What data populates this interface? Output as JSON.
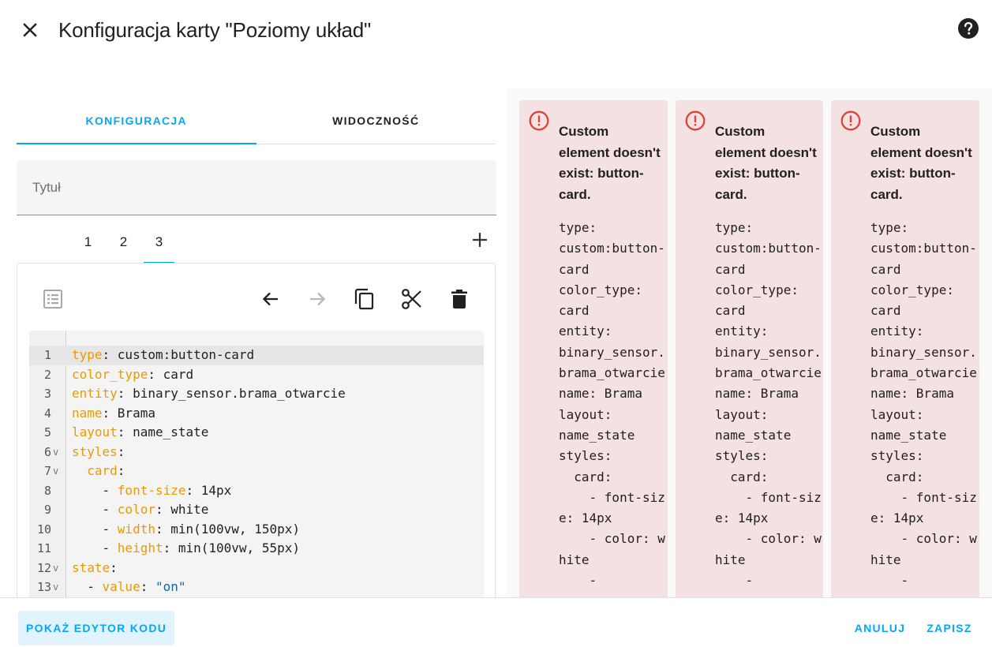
{
  "header": {
    "close_icon": "close-icon",
    "title": "Konfiguracja karty \"Poziomy układ\"",
    "help_icon": "help-circle-icon"
  },
  "tabs": [
    {
      "label": "Konfiguracja",
      "active": true
    },
    {
      "label": "Widoczność",
      "active": false
    }
  ],
  "title_field": {
    "placeholder": "Tytuł",
    "value": ""
  },
  "subtabs": {
    "items": [
      "1",
      "2",
      "3"
    ],
    "active_index": 2,
    "add_icon": "plus-icon"
  },
  "toolbar": {
    "icons": [
      "form-editor-icon",
      "arrow-left-icon",
      "arrow-right-icon",
      "copy-icon",
      "cut-icon",
      "delete-icon"
    ]
  },
  "code_editor": {
    "lines": [
      {
        "n": "1",
        "fold": "",
        "key": "type",
        "sep": ": ",
        "val": "custom:button-card",
        "indent": ""
      },
      {
        "n": "2",
        "fold": "",
        "key": "color_type",
        "sep": ": ",
        "val": "card",
        "indent": ""
      },
      {
        "n": "3",
        "fold": "",
        "key": "entity",
        "sep": ": ",
        "val": "binary_sensor.brama_otwarcie",
        "indent": ""
      },
      {
        "n": "4",
        "fold": "",
        "key": "name",
        "sep": ": ",
        "val": "Brama",
        "indent": ""
      },
      {
        "n": "5",
        "fold": "",
        "key": "layout",
        "sep": ": ",
        "val": "name_state",
        "indent": ""
      },
      {
        "n": "6",
        "fold": "v",
        "key": "styles",
        "sep": ":",
        "val": "",
        "indent": ""
      },
      {
        "n": "7",
        "fold": "v",
        "key": "card",
        "sep": ":",
        "val": "",
        "indent": "  "
      },
      {
        "n": "8",
        "fold": "",
        "key": "font-size",
        "sep": ": ",
        "val": "14px",
        "indent": "    - "
      },
      {
        "n": "9",
        "fold": "",
        "key": "color",
        "sep": ": ",
        "val": "white",
        "indent": "    - "
      },
      {
        "n": "10",
        "fold": "",
        "key": "width",
        "sep": ": ",
        "val": "min(100vw, 150px)",
        "indent": "    - "
      },
      {
        "n": "11",
        "fold": "",
        "key": "height",
        "sep": ": ",
        "val": "min(100vw, 55px)",
        "indent": "    - "
      },
      {
        "n": "12",
        "fold": "v",
        "key": "state",
        "sep": ":",
        "val": "",
        "indent": ""
      },
      {
        "n": "13",
        "fold": "v",
        "key": "value",
        "sep": ": ",
        "val": "\"on\"",
        "indent": "  - ",
        "string": true
      }
    ]
  },
  "preview": {
    "error_icon": "alert-circle-icon",
    "cards": [
      {
        "title": "Custom element doesn't exist: button-card.",
        "yaml": "type:\ncustom:button-card\ncolor_type:\ncard\nentity:\nbinary_sensor.brama_otwarcie\nname: Brama\nlayout:\nname_state\nstyles:\n  card:\n    - font-size: 14px\n    - color: white\n    -"
      },
      {
        "title": "Custom element doesn't exist: button-card.",
        "yaml": "type:\ncustom:button-card\ncolor_type:\ncard\nentity:\nbinary_sensor.brama_otwarcie\nname: Brama\nlayout:\nname_state\nstyles:\n  card:\n    - font-size: 14px\n    - color: white\n    -"
      },
      {
        "title": "Custom element doesn't exist: button-card.",
        "yaml": "type:\ncustom:button-card\ncolor_type:\ncard\nentity:\nbinary_sensor.brama_otwarcie\nname: Brama\nlayout:\nname_state\nstyles:\n  card:\n    - font-size: 14px\n    - color: white\n    -"
      }
    ]
  },
  "footer": {
    "show_code_editor": "Pokaż edytor kodu",
    "cancel": "Anuluj",
    "save": "Zapisz"
  },
  "colors": {
    "accent": "#03a9f4",
    "yaml_key": "#e99b00",
    "error_bg": "#f4e1e1",
    "error_icon": "#db4437"
  }
}
